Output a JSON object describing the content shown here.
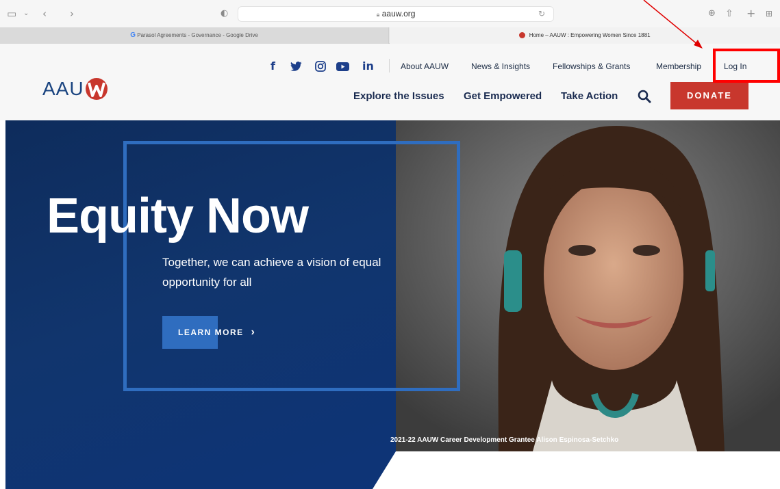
{
  "browser": {
    "url": "aauw.org",
    "tabs": [
      {
        "label": "Parasol Agreements - Governance - Google Drive",
        "favicon": "G"
      },
      {
        "label": "Home – AAUW : Empowering Women Since 1881"
      }
    ]
  },
  "header": {
    "logo_text": "AAU",
    "social_icons": [
      "facebook-icon",
      "twitter-icon",
      "instagram-icon",
      "youtube-icon",
      "linkedin-icon"
    ],
    "social_glyphs": {
      "facebook": "f",
      "linkedin": "in"
    },
    "utility_nav": [
      "About AAUW",
      "News & Insights",
      "Fellowships & Grants",
      "Membership",
      "Log In"
    ],
    "primary_nav": [
      "Explore the Issues",
      "Get Empowered",
      "Take Action"
    ],
    "donate_label": "DONATE"
  },
  "hero": {
    "title": "Equity Now",
    "subtitle": "Together, we can achieve a vision of equal opportunity for all",
    "cta_label": "LEARN MORE",
    "cta_chevron": "›",
    "caption": "2021-22 AAUW Career Development Grantee Alison Espinosa-Setchko"
  },
  "colors": {
    "brand_navy": "#1a4480",
    "donate_red": "#c8372d",
    "accent_blue": "#2f6dbf",
    "annotation_red": "#ff0000"
  }
}
